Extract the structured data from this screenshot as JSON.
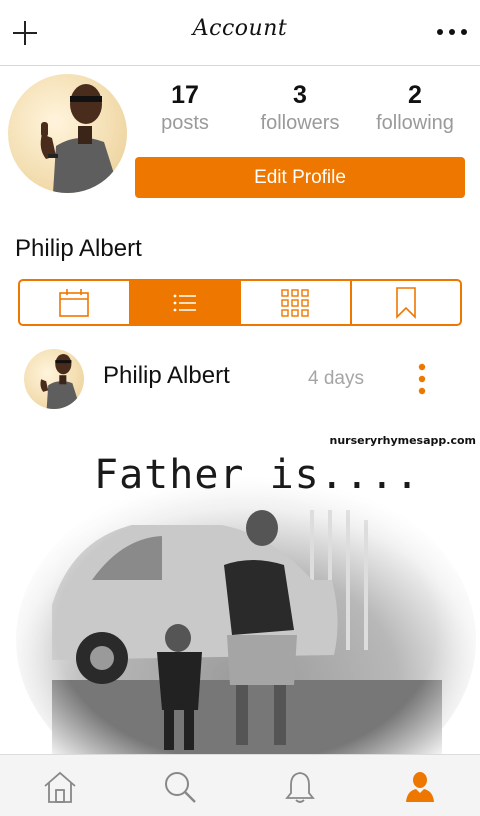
{
  "topbar": {
    "title": "Account",
    "left_icon": "plus-icon",
    "right_icon": "more-horizontal-icon"
  },
  "profile": {
    "name": "Philip Albert",
    "stats": {
      "posts": {
        "count": "17",
        "label": "posts"
      },
      "followers": {
        "count": "3",
        "label": "followers"
      },
      "following": {
        "count": "2",
        "label": "following"
      }
    },
    "edit_label": "Edit Profile"
  },
  "view_tabs": [
    {
      "icon": "calendar-icon",
      "active": false
    },
    {
      "icon": "list-icon",
      "active": true
    },
    {
      "icon": "grid-icon",
      "active": false
    },
    {
      "icon": "bookmark-icon",
      "active": false
    }
  ],
  "post": {
    "author": "Philip Albert",
    "time": "4 days",
    "image": {
      "watermark": "nurseryrhymesapp.com",
      "caption": "Father is...."
    }
  },
  "bottom_nav": [
    {
      "icon": "home-icon",
      "active": false
    },
    {
      "icon": "search-icon",
      "active": false
    },
    {
      "icon": "bell-icon",
      "active": false
    },
    {
      "icon": "profile-icon",
      "active": true
    }
  ],
  "colors": {
    "accent": "#ee7700",
    "muted_text": "#9a9a9a",
    "nav_background": "#f4f4f4"
  }
}
